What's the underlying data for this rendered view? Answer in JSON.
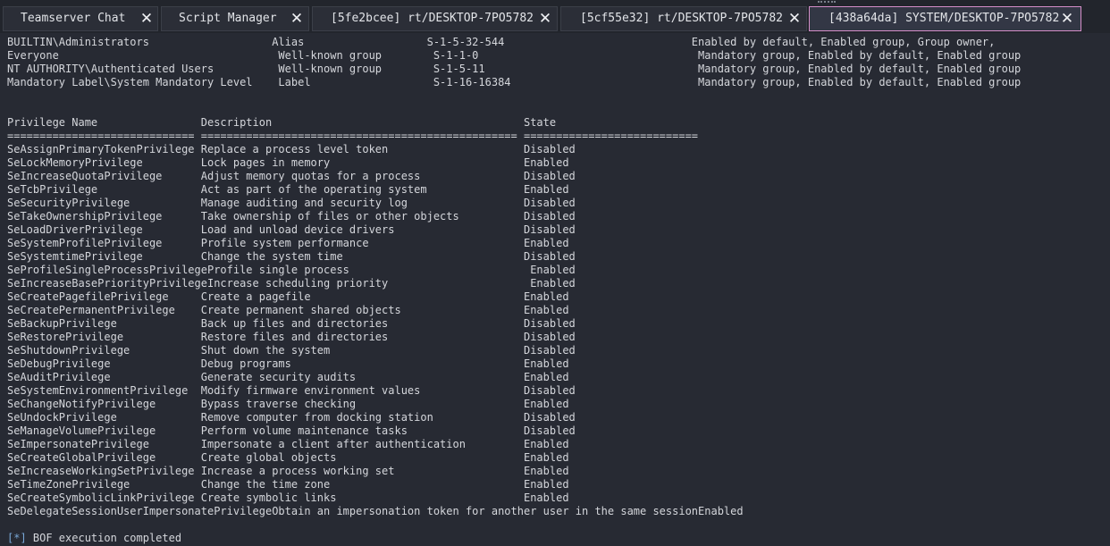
{
  "tabs": [
    {
      "label": "Teamserver Chat",
      "close": "✕",
      "active": false
    },
    {
      "label": "Script Manager",
      "close": "✕",
      "active": false
    },
    {
      "label": "[5fe2bcee] rt/DESKTOP-7PO5782",
      "close": "✕",
      "active": false
    },
    {
      "label": "[5cf55e32] rt/DESKTOP-7PO5782",
      "close": "✕",
      "active": false
    },
    {
      "label": "[438a64da] SYSTEM/DESKTOP-7PO5782",
      "close": "✕",
      "active": true
    }
  ],
  "groups": [
    "BUILTIN\\Administrators                   Alias                   S-1-5-32-544                             Enabled by default, Enabled group, Group owner,",
    "Everyone                                  Well-known group        S-1-1-0                                  Mandatory group, Enabled by default, Enabled group",
    "NT AUTHORITY\\Authenticated Users          Well-known group        S-1-5-11                                 Mandatory group, Enabled by default, Enabled group",
    "Mandatory Label\\System Mandatory Level    Label                   S-1-16-16384                             Mandatory group, Enabled by default, Enabled group"
  ],
  "privileges": {
    "header": "Privilege Name                Description                                       State",
    "separator": "============================= ================================================= ===========================",
    "rows": [
      "SeAssignPrimaryTokenPrivilege Replace a process level token                     Disabled",
      "SeLockMemoryPrivilege         Lock pages in memory                              Enabled",
      "SeIncreaseQuotaPrivilege      Adjust memory quotas for a process                Disabled",
      "SeTcbPrivilege                Act as part of the operating system               Enabled",
      "SeSecurityPrivilege           Manage auditing and security log                  Disabled",
      "SeTakeOwnershipPrivilege      Take ownership of files or other objects          Disabled",
      "SeLoadDriverPrivilege         Load and unload device drivers                    Disabled",
      "SeSystemProfilePrivilege      Profile system performance                        Enabled",
      "SeSystemtimePrivilege         Change the system time                            Disabled",
      "SeProfileSingleProcessPrivilegeProfile single process                            Enabled",
      "SeIncreaseBasePriorityPrivilegeIncrease scheduling priority                      Enabled",
      "SeCreatePagefilePrivilege     Create a pagefile                                 Enabled",
      "SeCreatePermanentPrivilege    Create permanent shared objects                   Enabled",
      "SeBackupPrivilege             Back up files and directories                     Disabled",
      "SeRestorePrivilege            Restore files and directories                     Disabled",
      "SeShutdownPrivilege           Shut down the system                              Disabled",
      "SeDebugPrivilege              Debug programs                                    Enabled",
      "SeAuditPrivilege              Generate security audits                          Enabled",
      "SeSystemEnvironmentPrivilege  Modify firmware environment values                Disabled",
      "SeChangeNotifyPrivilege       Bypass traverse checking                          Enabled",
      "SeUndockPrivilege             Remove computer from docking station              Disabled",
      "SeManageVolumePrivilege       Perform volume maintenance tasks                  Disabled",
      "SeImpersonatePrivilege        Impersonate a client after authentication         Enabled",
      "SeCreateGlobalPrivilege       Create global objects                             Enabled",
      "SeIncreaseWorkingSetPrivilege Increase a process working set                    Enabled",
      "SeTimeZonePrivilege           Change the time zone                              Enabled",
      "SeCreateSymbolicLinkPrivilege Create symbolic links                             Enabled",
      "SeDelegateSessionUserImpersonatePrivilegeObtain an impersonation token for another user in the same sessionEnabled"
    ]
  },
  "status": {
    "prefix": "[*]",
    "text": " BOF execution completed"
  },
  "colors": {
    "active_tab_border": "#d58fc9",
    "status_prefix": "#79a8d8",
    "background": "#272a33"
  }
}
